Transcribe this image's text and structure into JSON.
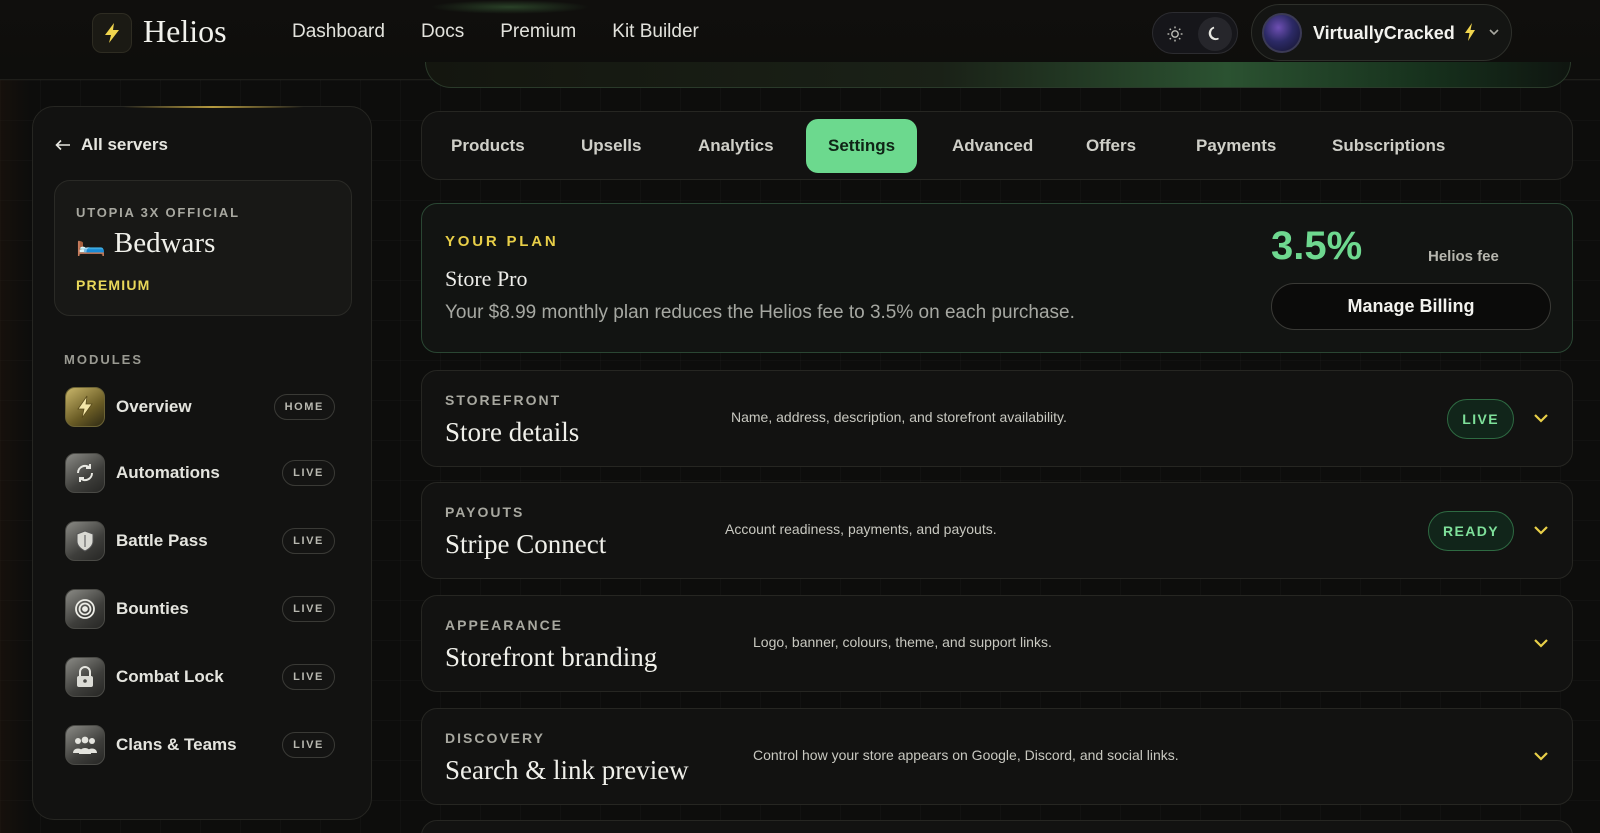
{
  "brand": {
    "name": "Helios",
    "logo_icon": "bolt-icon"
  },
  "nav": {
    "links": [
      "Dashboard",
      "Docs",
      "Premium",
      "Kit Builder"
    ]
  },
  "theme": {
    "light_icon": "sun-icon",
    "dark_icon": "moon-icon",
    "selected": "dark"
  },
  "user": {
    "name": "VirtuallyCracked",
    "badge_icon": "bolt-icon"
  },
  "sidebar": {
    "back_label": "All servers",
    "server": {
      "subtitle": "UTOPIA 3X OFFICIAL",
      "emoji": "🛏️",
      "name": "Bedwars",
      "tier": "PREMIUM"
    },
    "modules_label": "MODULES",
    "modules": [
      {
        "label": "Overview",
        "badge": "HOME",
        "icon": "lightning-icon"
      },
      {
        "label": "Automations",
        "badge": "LIVE",
        "icon": "cycle-icon"
      },
      {
        "label": "Battle Pass",
        "badge": "LIVE",
        "icon": "shield-icon"
      },
      {
        "label": "Bounties",
        "badge": "LIVE",
        "icon": "target-icon"
      },
      {
        "label": "Combat Lock",
        "badge": "LIVE",
        "icon": "lock-icon"
      },
      {
        "label": "Clans & Teams",
        "badge": "LIVE",
        "icon": "group-icon"
      }
    ]
  },
  "tabs": {
    "items": [
      "Products",
      "Upsells",
      "Analytics",
      "Settings",
      "Advanced",
      "Offers",
      "Payments",
      "Subscriptions"
    ],
    "active": "Settings"
  },
  "plan": {
    "kicker": "YOUR PLAN",
    "title": "Store Pro",
    "description": "Your $8.99 monthly plan reduces the Helios fee to 3.5% on each purchase.",
    "fee_percent": "3.5%",
    "fee_label": "Helios fee",
    "billing_button": "Manage Billing"
  },
  "sections": [
    {
      "kicker": "STOREFRONT",
      "title": "Store details",
      "description": "Name, address, description, and storefront availability.",
      "status": "LIVE"
    },
    {
      "kicker": "PAYOUTS",
      "title": "Stripe Connect",
      "description": "Account readiness, payments, and payouts.",
      "status": "READY"
    },
    {
      "kicker": "APPEARANCE",
      "title": "Storefront branding",
      "description": "Logo, banner, colours, theme, and support links.",
      "status": ""
    },
    {
      "kicker": "DISCOVERY",
      "title": "Search & link preview",
      "description": "Control how your store appears on Google, Discord, and social links.",
      "status": ""
    }
  ],
  "colors": {
    "accent_green": "#6cd98e",
    "accent_gold": "#e8cf48",
    "background": "#0d0d0c"
  }
}
